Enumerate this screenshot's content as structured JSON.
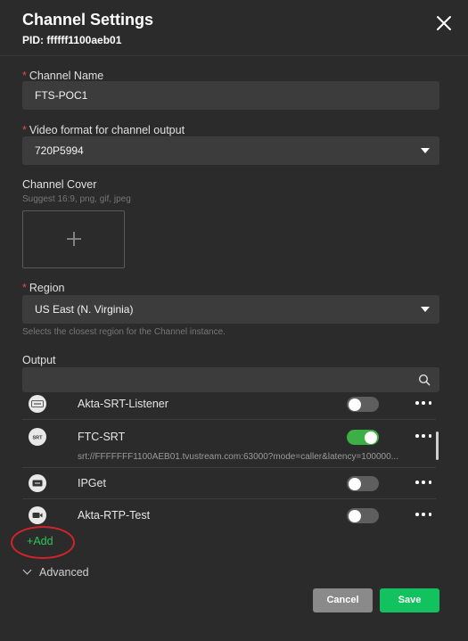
{
  "dialog": {
    "title": "Channel Settings",
    "pid": "PID: ffffff1100aeb01"
  },
  "channel_name": {
    "label": "Channel Name",
    "value": "FTS-POC1",
    "required_mark": "*"
  },
  "video_format": {
    "label": "Video format for channel output",
    "value": "720P5994",
    "required_mark": "*"
  },
  "channel_cover": {
    "label": "Channel Cover",
    "hint": "Suggest 16:9, png, gif, jpeg",
    "add_glyph": "+"
  },
  "region": {
    "label": "Region",
    "value": "US East (N. Virginia)",
    "hint": "Selects the closest region for the Channel instance.",
    "required_mark": "*"
  },
  "output": {
    "label": "Output",
    "search_placeholder": "",
    "items": [
      {
        "name": "Akta-SRT-Listener",
        "icon": "srt-icon",
        "enabled": false,
        "url": ""
      },
      {
        "name": "FTC-SRT",
        "icon": "srt-icon",
        "enabled": true,
        "url": "srt://FFFFFFF1100AEB01.tvustream.com:63000?mode=caller&latency=100000..."
      },
      {
        "name": "IPGet",
        "icon": "ip-icon",
        "enabled": false,
        "url": ""
      },
      {
        "name": "Akta-RTP-Test",
        "icon": "camera-icon",
        "enabled": false,
        "url": ""
      }
    ],
    "add_label": "Add",
    "add_glyph": "+"
  },
  "advanced": {
    "label": "Advanced"
  },
  "footer": {
    "cancel_label": "Cancel",
    "save_label": "Save"
  },
  "colors": {
    "background": "#2b2b2b",
    "field": "#3c3c3c",
    "accent_green": "#11c25e",
    "toggle_on": "#3cb044",
    "required": "#e5484d",
    "annotation_red": "#d2232a"
  }
}
